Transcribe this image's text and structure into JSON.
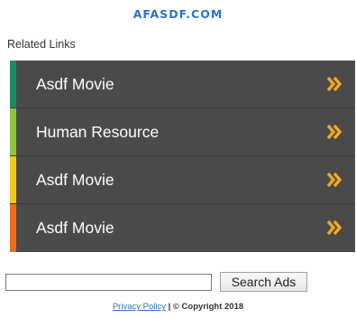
{
  "header": {
    "site_title": "AFASDF.COM"
  },
  "related": {
    "label": "Related Links",
    "items": [
      {
        "label": "Asdf Movie",
        "accent": "#1e8a6a"
      },
      {
        "label": "Human Resource",
        "accent": "#8cc63f"
      },
      {
        "label": "Asdf Movie",
        "accent": "#f2c81a"
      },
      {
        "label": "Asdf Movie",
        "accent": "#ee6a1c"
      }
    ],
    "chevron_icon": "double-chevron-right-icon",
    "chevron_color": "#f3a81c"
  },
  "search": {
    "value": "",
    "button_label": "Search Ads"
  },
  "footer": {
    "privacy_label": "Privacy Policy",
    "separator": " | ",
    "copyright": "© Copyright 2018"
  }
}
